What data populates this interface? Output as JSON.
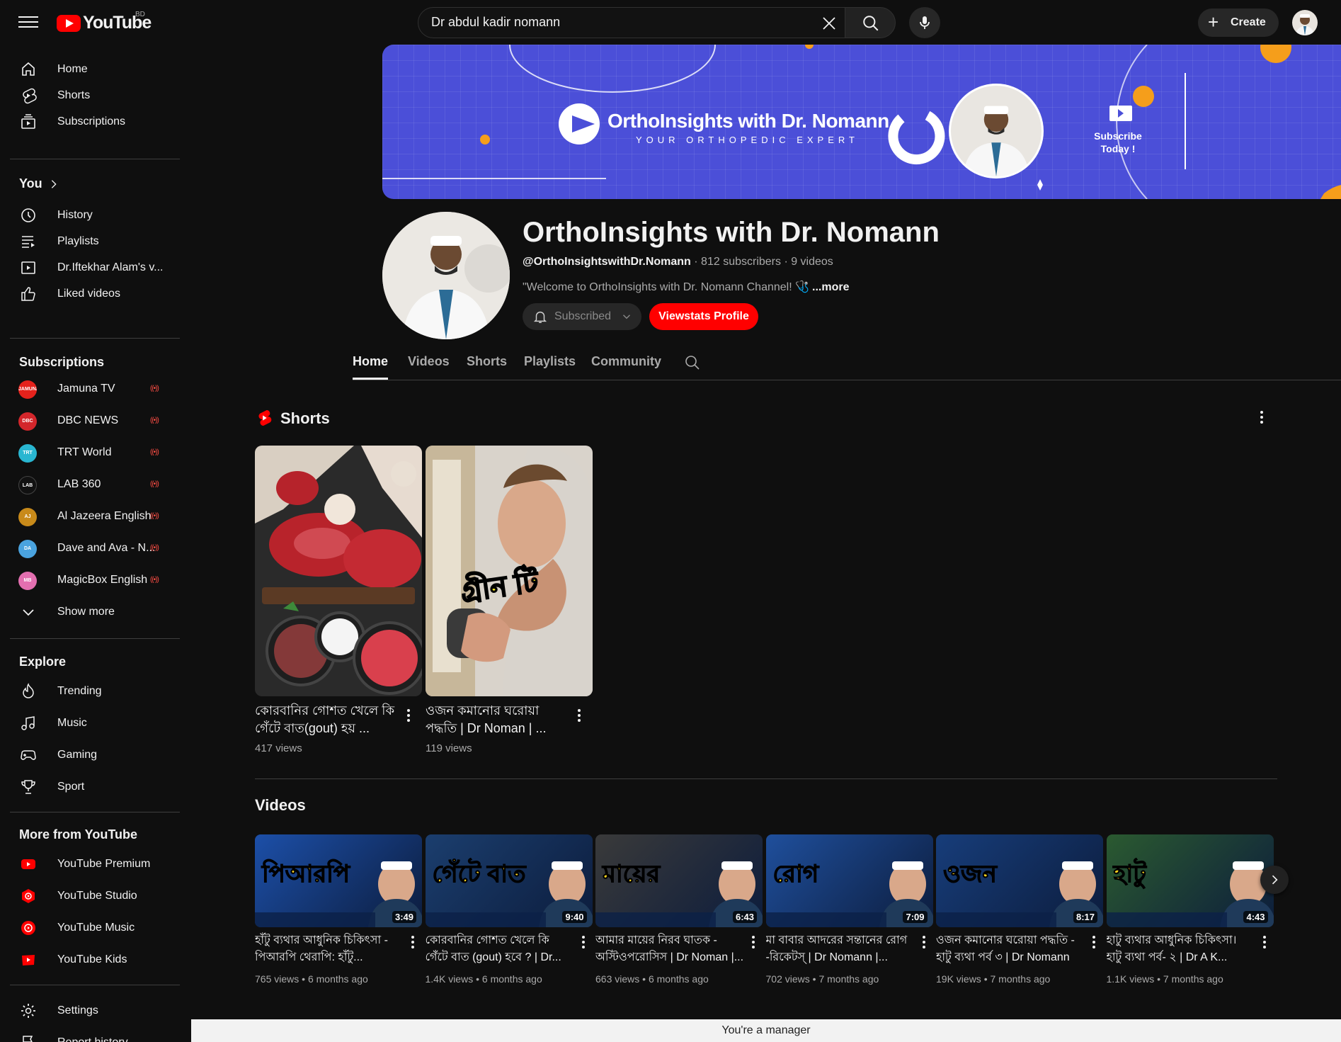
{
  "header": {
    "logo_text": "YouTube",
    "country_code": "BD",
    "search_value": "Dr abdul kadir nomann",
    "create_label": "Create"
  },
  "sidebar": {
    "main": [
      {
        "label": "Home",
        "icon": "home-icon"
      },
      {
        "label": "Shorts",
        "icon": "shorts-icon"
      },
      {
        "label": "Subscriptions",
        "icon": "subscriptions-icon"
      }
    ],
    "you_heading": "You",
    "you_items": [
      {
        "label": "History",
        "icon": "history-icon"
      },
      {
        "label": "Playlists",
        "icon": "playlists-icon"
      },
      {
        "label": "Dr.Iftekhar Alam's v...",
        "icon": "playlist-play-icon"
      },
      {
        "label": "Liked videos",
        "icon": "thumbs-up-icon"
      }
    ],
    "subscriptions_heading": "Subscriptions",
    "subscriptions": [
      {
        "label": "Jamuna TV",
        "color": "#e5221c",
        "mark": "JAMUNA"
      },
      {
        "label": "DBC NEWS",
        "color": "#d3262b",
        "mark": "DBC"
      },
      {
        "label": "TRT World",
        "color": "#29b6d1",
        "mark": "TRT"
      },
      {
        "label": "LAB 360",
        "color": "#111111",
        "mark": "LAB"
      },
      {
        "label": "Al Jazeera English",
        "color": "#c88a1a",
        "mark": "AJ"
      },
      {
        "label": "Dave and Ava - N...",
        "color": "#4aa3df",
        "mark": "DA"
      },
      {
        "label": "MagicBox English",
        "color": "#e36fb0",
        "mark": "MB"
      }
    ],
    "live_indicator": "((•))",
    "show_more": "Show more",
    "explore_heading": "Explore",
    "explore": [
      {
        "label": "Trending",
        "icon": "trending-icon"
      },
      {
        "label": "Music",
        "icon": "music-icon"
      },
      {
        "label": "Gaming",
        "icon": "gaming-icon"
      },
      {
        "label": "Sport",
        "icon": "trophy-icon"
      }
    ],
    "more_heading": "More from YouTube",
    "more": [
      {
        "label": "YouTube Premium"
      },
      {
        "label": "YouTube Studio"
      },
      {
        "label": "YouTube Music"
      },
      {
        "label": "YouTube Kids"
      }
    ],
    "settings": "Settings",
    "report_history": "Report history"
  },
  "banner": {
    "title": "OrthoInsights with Dr. Nomann",
    "tagline": "YOUR ORTHOPEDIC EXPERT",
    "cta": "Subscribe Today !"
  },
  "channel": {
    "name": "OrthoInsights with Dr. Nomann",
    "handle": "@OrthoInsightswithDr.Nomann",
    "stats": " · 812 subscribers · 9 videos",
    "description": "\"Welcome to OrthoInsights with Dr. Nomann Channel! 🩺",
    "more": "...more",
    "subscribed_label": "Subscribed",
    "viewstats_label": "Viewstats Profile"
  },
  "tabs": [
    "Home",
    "Videos",
    "Shorts",
    "Playlists",
    "Community"
  ],
  "shorts": {
    "heading": "Shorts",
    "items": [
      {
        "title": "কোরবানির গোশত খেলে কি গেঁটে বাত(gout) হয় ...",
        "views": "417 views"
      },
      {
        "title": "ওজন কমানোর ঘরোয়া পদ্ধতি | Dr Noman | ...",
        "views": "119 views",
        "overlay": "গ্রীন টি"
      }
    ]
  },
  "videos": {
    "heading": "Videos",
    "items": [
      {
        "title": "হাঁটু ব্যথার আধুনিক চিকিৎসা - পিআরপি থেরাপি: হাঁটু...",
        "views": "765 views",
        "age": "6 months ago",
        "duration": "3:49",
        "thumb_text": "পিআরপি",
        "color": "#1c4fa8"
      },
      {
        "title": "কোরবানির গোশত খেলে কি গেঁটে বাত (gout) হবে ? | Dr...",
        "views": "1.4K views",
        "age": "6 months ago",
        "duration": "9:40",
        "thumb_text": "গেঁটে বাত",
        "color": "#1b3e6e"
      },
      {
        "title": "আমার মায়ের নিরব ঘাতক - অস্টিওপরোসিস | Dr Noman |...",
        "views": "663 views",
        "age": "6 months ago",
        "duration": "6:43",
        "thumb_text": "মায়ের",
        "color": "#3a3a3a"
      },
      {
        "title": "মা বাবার আদরের সন্তানের রোগ -রিকেটস্ | Dr Nomann |...",
        "views": "702 views",
        "age": "7 months ago",
        "duration": "7:09",
        "thumb_text": "রোগ",
        "color": "#1f4f9c"
      },
      {
        "title": "ওজন কমানোর ঘরোয়া পদ্ধতি - হাটু ব্যথা পর্ব ৩ | Dr Nomann |...",
        "views": "19K views",
        "age": "7 months ago",
        "duration": "8:17",
        "thumb_text": "ওজন",
        "color": "#173d7a"
      },
      {
        "title": "হাটু ব্যথার আধুনিক চিকিৎসা। হাটু ব্যথা পর্ব- ২ | Dr A K...",
        "views": "1.1K views",
        "age": "7 months ago",
        "duration": "4:43",
        "thumb_text": "হাটু",
        "color": "#2b5a30"
      }
    ]
  },
  "footer": {
    "manager_notice": "You're a manager"
  },
  "colors": {
    "accent": "#ff0000",
    "banner": "#4b4fd8",
    "background": "#0f0f0f"
  }
}
